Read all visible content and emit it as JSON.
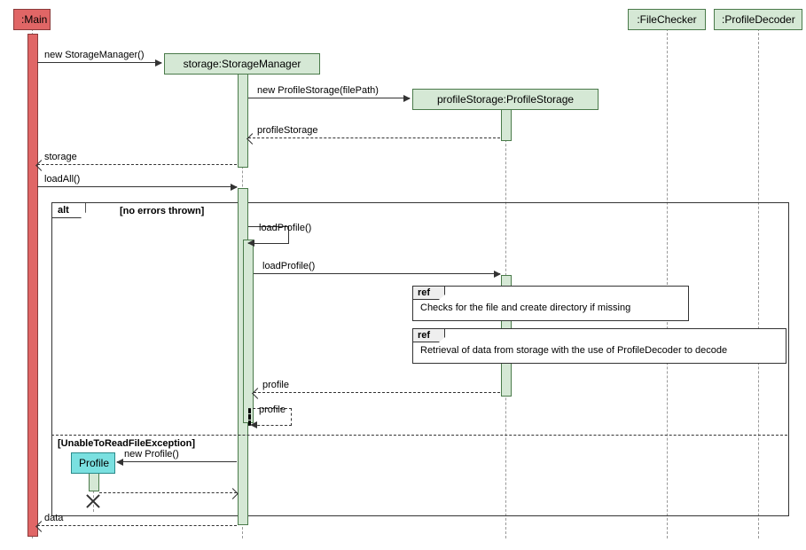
{
  "participants": {
    "main": ":Main",
    "storage": "storage:StorageManager",
    "profileStorage": "profileStorage:ProfileStorage",
    "fileChecker": ":FileChecker",
    "profileDecoder": ":ProfileDecoder",
    "profile": "Profile"
  },
  "messages": {
    "newStorage": "new StorageManager()",
    "newProfileStorage": "new ProfileStorage(filePath)",
    "retProfileStorage": "profileStorage",
    "retStorage": "storage",
    "loadAll": "loadAll()",
    "loadProfile1": "loadProfile()",
    "loadProfile2": "loadProfile()",
    "retProfile1": "profile",
    "retProfile2": "profile",
    "newProfile": "new Profile()",
    "retData": "data"
  },
  "frames": {
    "alt": "alt",
    "guard1": "[no errors thrown]",
    "guard2": "[UnableToReadFileException]",
    "ref": "ref",
    "refText1": "Checks for the file and create directory if missing",
    "refText2": "Retrieval of data from storage with the use of ProfileDecoder to decode"
  }
}
